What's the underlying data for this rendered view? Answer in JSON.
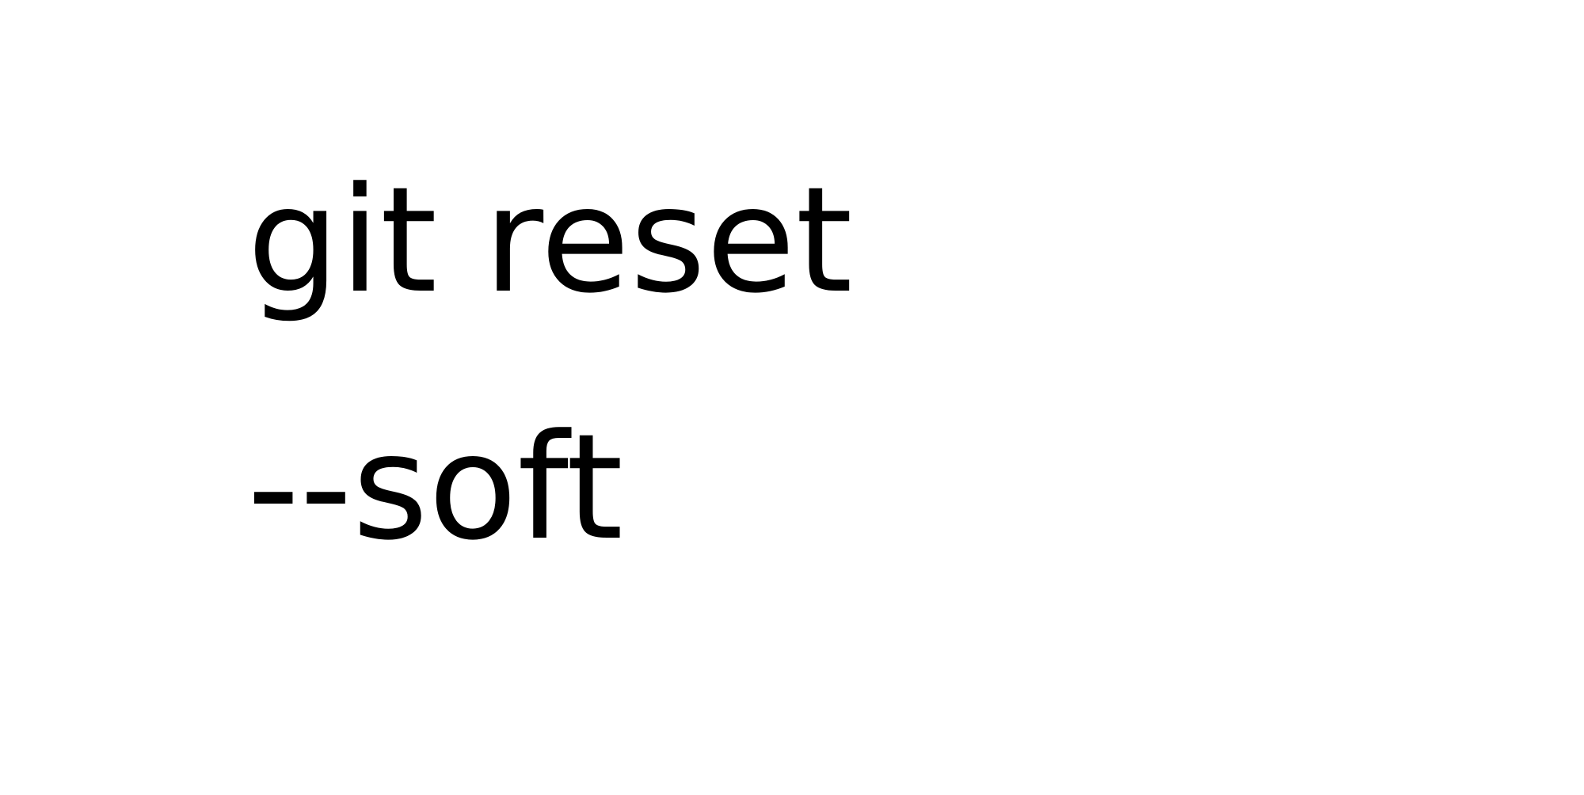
{
  "text": {
    "line1": "git reset",
    "line2": "--soft"
  },
  "colors": {
    "background": "#ffffff",
    "text": "#000000"
  }
}
